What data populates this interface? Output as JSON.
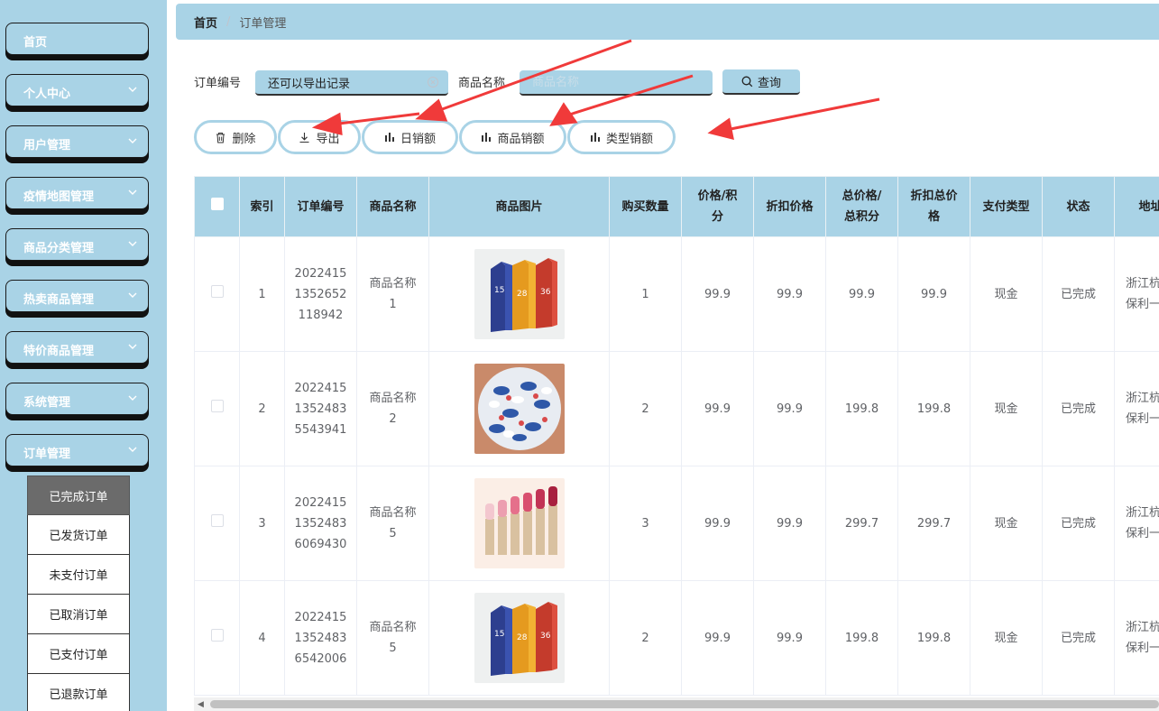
{
  "sidebar": {
    "items": [
      {
        "label": "首页"
      },
      {
        "label": "个人中心"
      },
      {
        "label": "用户管理"
      },
      {
        "label": "疫情地图管理"
      },
      {
        "label": "商品分类管理"
      },
      {
        "label": "热卖商品管理"
      },
      {
        "label": "特价商品管理"
      },
      {
        "label": "系统管理"
      },
      {
        "label": "订单管理"
      }
    ],
    "submenu": [
      {
        "label": "已完成订单",
        "active": true
      },
      {
        "label": "已发货订单"
      },
      {
        "label": "未支付订单"
      },
      {
        "label": "已取消订单"
      },
      {
        "label": "已支付订单"
      },
      {
        "label": "已退款订单"
      }
    ]
  },
  "breadcrumb": {
    "home": "首页",
    "separator": "/",
    "current": "订单管理"
  },
  "search": {
    "order_no_label": "订单编号",
    "order_no_value": "还可以导出记录",
    "product_name_label": "商品名称",
    "product_name_placeholder": "商品名称",
    "query_label": "查询"
  },
  "actions": {
    "delete": "删除",
    "export": "导出",
    "daily_sales": "日销额",
    "product_sales": "商品销额",
    "category_sales": "类型销额"
  },
  "table": {
    "columns": {
      "index": "索引",
      "order_no": "订单编号",
      "product_name": "商品名称",
      "image": "商品图片",
      "qty": "购买数量",
      "price_1": "价格/积",
      "price_2": "分",
      "discount": "折扣价格",
      "total_1": "总价格/",
      "total_2": "总积分",
      "disc_total_1": "折扣总价",
      "disc_total_2": "格",
      "pay_type": "支付类型",
      "status": "状态",
      "address": "地址"
    },
    "rows": [
      {
        "index": "1",
        "order_1": "2022415",
        "order_2": "1352652",
        "order_3": "118942",
        "name_1": "商品名称",
        "name_2": "1",
        "image": "juice-cartons",
        "qty": "1",
        "price": "99.9",
        "discount": "99.9",
        "total": "99.9",
        "disc_total": "99.9",
        "pay_type": "现金",
        "status": "已完成",
        "addr_1": "浙江杭",
        "addr_2": "保利一"
      },
      {
        "index": "2",
        "order_1": "2022415",
        "order_2": "1352483",
        "order_3": "5543941",
        "name_1": "商品名称",
        "name_2": "2",
        "image": "candy-bowl",
        "qty": "2",
        "price": "99.9",
        "discount": "99.9",
        "total": "199.8",
        "disc_total": "199.8",
        "pay_type": "现金",
        "status": "已完成",
        "addr_1": "浙江杭",
        "addr_2": "保利一"
      },
      {
        "index": "3",
        "order_1": "2022415",
        "order_2": "1352483",
        "order_3": "6069430",
        "name_1": "商品名称",
        "name_2": "5",
        "image": "lipsticks",
        "qty": "3",
        "price": "99.9",
        "discount": "99.9",
        "total": "299.7",
        "disc_total": "299.7",
        "pay_type": "现金",
        "status": "已完成",
        "addr_1": "浙江杭",
        "addr_2": "保利一"
      },
      {
        "index": "4",
        "order_1": "2022415",
        "order_2": "1352483",
        "order_3": "6542006",
        "name_1": "商品名称",
        "name_2": "5",
        "image": "juice-cartons",
        "qty": "2",
        "price": "99.9",
        "discount": "99.9",
        "total": "199.8",
        "disc_total": "199.8",
        "pay_type": "现金",
        "status": "已完成",
        "addr_1": "浙江杭",
        "addr_2": "保利一"
      }
    ]
  },
  "colors": {
    "accent": "#a9d3e6",
    "annotation": "#f03a3a"
  }
}
